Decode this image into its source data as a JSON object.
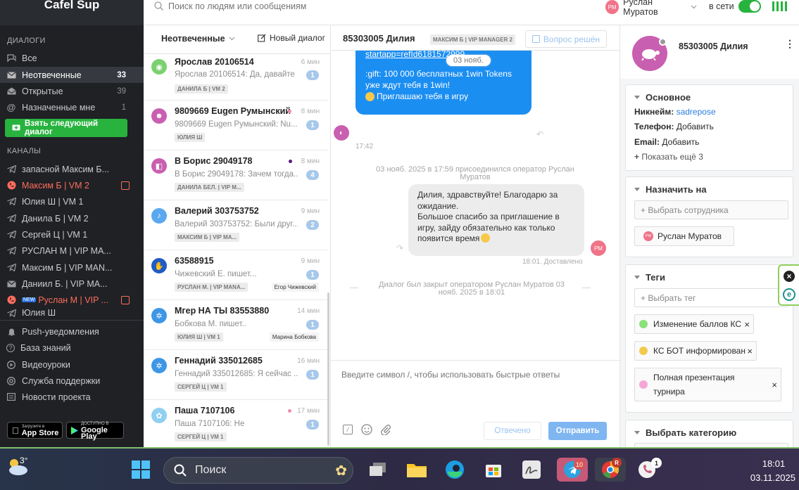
{
  "brand": "Cafel Sup",
  "sidebar": {
    "dialogs_title": "ДИАЛОГИ",
    "items": [
      {
        "label": "Все",
        "count": ""
      },
      {
        "label": "Неотвеченные",
        "count": "33"
      },
      {
        "label": "Открытые",
        "count": "39"
      },
      {
        "label": "Назначенные мне",
        "count": "1"
      }
    ],
    "take_next": "Взять следующий диалог",
    "channels_title": "КАНАЛЫ",
    "channels": [
      "запасной Максим Б...",
      "Максим Б | VM 2",
      "Юлия Ш | VM 1",
      "Данила Б | VM 2",
      "Сергей Ц | VM 1",
      "РУСЛАН М | VIP МА...",
      "Максим Б | VIP MAN...",
      "Даниил Б. | VIP МА...",
      "Руслан М | VIP ...",
      "Юлия Ш"
    ],
    "bottom": [
      "Push-уведомления",
      "База знаний",
      "Видеоуроки",
      "Служба поддержки",
      "Новости проекта"
    ],
    "appstore_small": "Загрузите в",
    "appstore": "App Store",
    "gplay_small": "ДОСТУПНО В",
    "gplay": "Google Play"
  },
  "topbar": {
    "search_placeholder": "Поиск по людям или сообщениям",
    "user_initials": "РМ",
    "user_name": "Руслан Муратов",
    "status": "в сети"
  },
  "list": {
    "filter": "Неотвеченные",
    "new_dialog": "Новый диалог",
    "items": [
      {
        "name": "Ярослав 20106514",
        "time": "6 мин",
        "preview": "Ярослав 20106514: Да, давайте",
        "badge": "1",
        "tag": "ДАНИЛА Б | VM 2",
        "operator": "",
        "color": "#7bd06f"
      },
      {
        "name": "9809669 Eugen Румынский",
        "time": "8 мин",
        "preview": "9809669 Eugen Румынский: Nu...",
        "badge": "1",
        "tag": "ЮЛИЯ Ш",
        "operator": "",
        "color": "#c95fb0"
      },
      {
        "name": "В Борис 29049178",
        "time": "8 мин",
        "preview": "В Борис 29049178: Зачем тогда...",
        "badge": "4",
        "tag": "ДАНИЛА БЕЛ. | VIP M...",
        "operator": "",
        "color": "#c95fb0"
      },
      {
        "name": "Валерий 303753752",
        "time": "9 мин",
        "preview": "Валерий 303753752: Были друг...",
        "badge": "2",
        "tag": "МАКСИМ Б | VIP MA...",
        "operator": "",
        "color": "#5aa8ef"
      },
      {
        "name": "63588915",
        "time": "9 мин",
        "preview": "Чижевский Е. пишет...",
        "badge": "1",
        "tag": "РУСЛАН М. | VIP MANA...",
        "operator": "Егор Чижевский",
        "color": "#1f5cc4"
      },
      {
        "name": "Мгер НА ТЫ 83553880",
        "time": "14 мин",
        "preview": "Бобкова М. пишет..",
        "badge": "1",
        "tag": "ЮЛИЯ Ш | VM 1",
        "operator": "Марина Бобкова",
        "color": "#3e96e6"
      },
      {
        "name": "Геннадий 335012685",
        "time": "16 мин",
        "preview": "Геннадий 335012685: Я сейчас ...",
        "badge": "1",
        "tag": "СЕРГЕЙ Ц | VM 1",
        "operator": "",
        "color": "#3e96e6"
      },
      {
        "name": "Паша 7107106",
        "time": "17 мин",
        "preview": "Паша 7107106: Не",
        "badge": "1",
        "tag": "СЕРГЕЙ Ц | VM 1",
        "operator": "",
        "color": "#8fd0f0"
      }
    ]
  },
  "chat": {
    "title": "85303005 Дилия",
    "channel_tag": "МАКСИМ Б | VIP MANAGER 2",
    "resolve": "Вопрос решён",
    "msg_in_link": "startapp=refId6181572999",
    "date_chip": "03 нояб.",
    "msg_in_line1": ":gift: 100 000 бесплатных 1win Tokens",
    "msg_in_line2": "уже ждут тебя в 1win!",
    "msg_in_line3": "Приглашаю тебя в игру",
    "msg_in_time": "17:42",
    "sys_joined": "03 нояб. 2025 в 17:59 присоединился оператор Руслан Муратов",
    "msg_out": "Дилия, здравствуйте! Благодарю за ожидание.\nБольшое спасибо за приглашение в игру, зайду обязательно как только появится время",
    "msg_out_initials": "РМ",
    "msg_out_time": "18:01. Доставлено",
    "sys_closed": "Диалог был закрыт оператором Руслан Муратов 03 нояб. 2025 в 18:01",
    "input_placeholder": "Введите символ /, чтобы использовать быстрые ответы",
    "answered": "Отвечено",
    "send": "Отправить"
  },
  "right": {
    "name": "85303005 Дилия",
    "basic_title": "Основное",
    "nick_label": "Никнейм:",
    "nick_value": "sadrepose",
    "phone_label": "Телефон:",
    "phone_value": "Добавить",
    "email_label": "Email:",
    "email_value": "Добавить",
    "show_more": "Показать ещё 3",
    "assign_title": "Назначить на",
    "assign_placeholder": "+ Выбрать сотрудника",
    "assignee_initials": "РМ",
    "assignee": "Руслан Муратов",
    "tags_title": "Теги",
    "tags_placeholder": "+ Выбрать тег",
    "tags": [
      {
        "label": "Изменение баллов КС",
        "color": "#8be27b"
      },
      {
        "label": "КС БОТ информирован",
        "color": "#f2c94c"
      },
      {
        "label": "Полная презентация турнира",
        "color": "#f5a6d8"
      }
    ],
    "category_title": "Выбрать категорию"
  },
  "taskbar": {
    "weather": "3°",
    "search": "Поиск",
    "telegram_badge": "10",
    "chrome_badge": "R",
    "viber_badge": "1",
    "time": "18:01",
    "date": "03.11.2025"
  }
}
